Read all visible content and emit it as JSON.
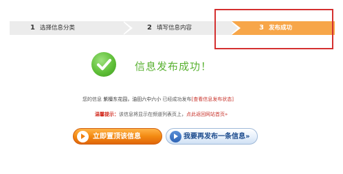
{
  "steps": [
    {
      "num": "1",
      "label": "选择信息分类"
    },
    {
      "num": "2",
      "label": "填写信息内容"
    },
    {
      "num": "3",
      "label": "发布成功"
    }
  ],
  "success": {
    "title": "信息发布成功！",
    "info_prefix": "您的信息",
    "info_house": "紫檀东花园，油田六中六小",
    "info_middle": "已经成功发布",
    "info_link": "[查看信息发布状态]",
    "tip_label": "温馨提示：",
    "tip_text": "该信息将显示在频道列表页上，",
    "tip_link": "点此返回网站首页»"
  },
  "buttons": {
    "promote": "立即置顶该信息",
    "publish_again": "我要再发布一条信息»"
  },
  "colors": {
    "active_step": "#f7a649",
    "inactive_step": "#ececec",
    "success_green": "#59b131",
    "highlight_red": "#d42f2f",
    "link_red": "#c8332b"
  }
}
